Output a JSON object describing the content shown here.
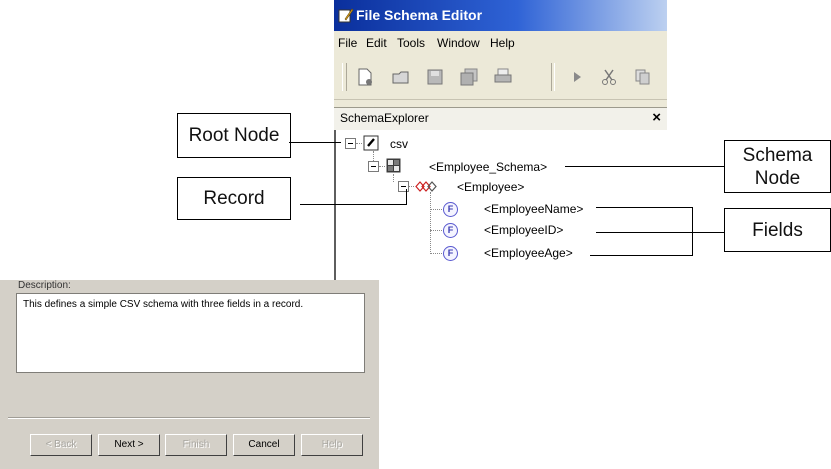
{
  "window": {
    "title": "File Schema Editor"
  },
  "menu": [
    "File",
    "Edit",
    "Tools",
    "Window",
    "Help"
  ],
  "toolbar": [
    "new-file-icon",
    "open-icon",
    "save-icon",
    "save-all-icon",
    "print-icon",
    "run-icon",
    "cut-icon",
    "copy-icon"
  ],
  "panel": {
    "title": "SchemaExplorer",
    "close": "×"
  },
  "tree": {
    "root": "csv",
    "schema": "<Employee_Schema>",
    "record": "<Employee>",
    "fields": [
      "<EmployeeName>",
      "<EmployeeID>",
      "<EmployeeAge>"
    ],
    "field_icon": "F"
  },
  "callouts": {
    "root": "Root Node",
    "record": "Record",
    "schema": "Schema\nNode",
    "fields": "Fields"
  },
  "wizard": {
    "description_label": "Description:",
    "description": "This defines a simple CSV schema with three fields in a record.",
    "buttons": [
      "< Back",
      "Next >",
      "Finish",
      "Cancel",
      "Help"
    ]
  }
}
